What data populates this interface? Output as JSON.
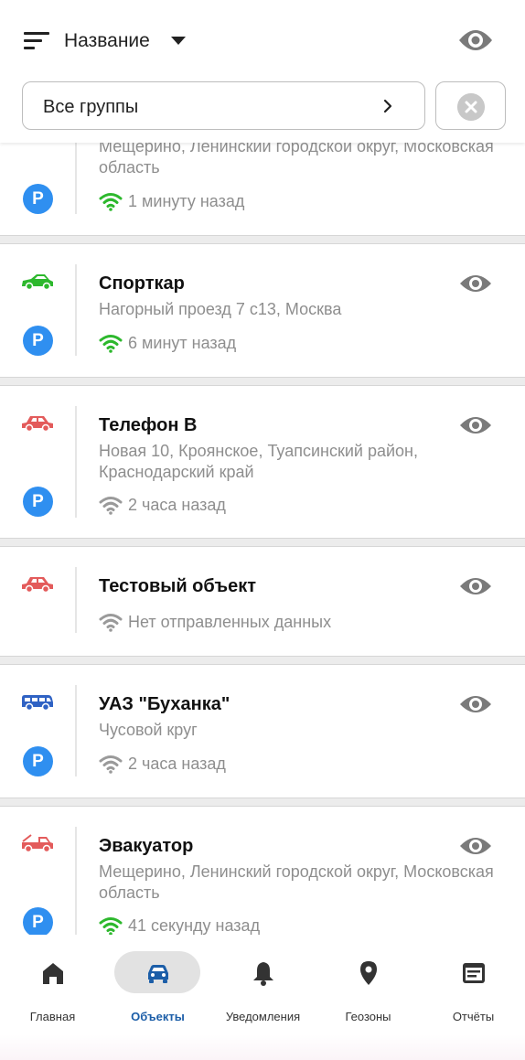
{
  "header": {
    "sort_label": "Название",
    "group_select_label": "Все группы"
  },
  "objects": [
    {
      "title": "",
      "address": "Мещерино, Ленинский городской округ, Московская область",
      "status": "1 минуту назад",
      "signal": "online",
      "vehicle_icon": "",
      "vehicle_color": "",
      "parked": true
    },
    {
      "title": "Спорткар",
      "address": "Нагорный проезд 7 с13, Москва",
      "status": "6 минут назад",
      "signal": "online",
      "vehicle_icon": "sports-car-icon",
      "vehicle_color": "#2db82d",
      "parked": true
    },
    {
      "title": "Телефон В",
      "address": "Новая  10, Кроянское, Туапсинский район, Краснодарский край",
      "status": "2 часа назад",
      "signal": "offline",
      "vehicle_icon": "car-icon",
      "vehicle_color": "#e35b5b",
      "parked": true
    },
    {
      "title": "Тестовый объект",
      "address": "",
      "status": "Нет отправленных данных",
      "signal": "offline",
      "vehicle_icon": "car-icon",
      "vehicle_color": "#e35b5b",
      "parked": false
    },
    {
      "title": "УАЗ \"Буханка\"",
      "address": "Чусовой круг",
      "status": "2 часа назад",
      "signal": "offline",
      "vehicle_icon": "van-icon",
      "vehicle_color": "#2f62c4",
      "parked": true
    },
    {
      "title": "Эвакуатор",
      "address": "Мещерино, Ленинский городской округ, Московская область",
      "status": "41 секунду назад",
      "signal": "online",
      "vehicle_icon": "tow-truck-icon",
      "vehicle_color": "#e35b5b",
      "parked": true
    }
  ],
  "badges": {
    "parking": "P"
  },
  "colors": {
    "signal_online": "#2db82d",
    "signal_offline": "#9a9a9a",
    "accent": "#1c5ea8",
    "parking_badge": "#2f8ff0"
  },
  "nav": [
    {
      "label": "Главная",
      "icon": "home-icon",
      "active": false
    },
    {
      "label": "Объекты",
      "icon": "car-icon",
      "active": true
    },
    {
      "label": "Уведомления",
      "icon": "bell-icon",
      "active": false
    },
    {
      "label": "Геозоны",
      "icon": "location-pin-icon",
      "active": false
    },
    {
      "label": "Отчёты",
      "icon": "report-icon",
      "active": false
    }
  ]
}
